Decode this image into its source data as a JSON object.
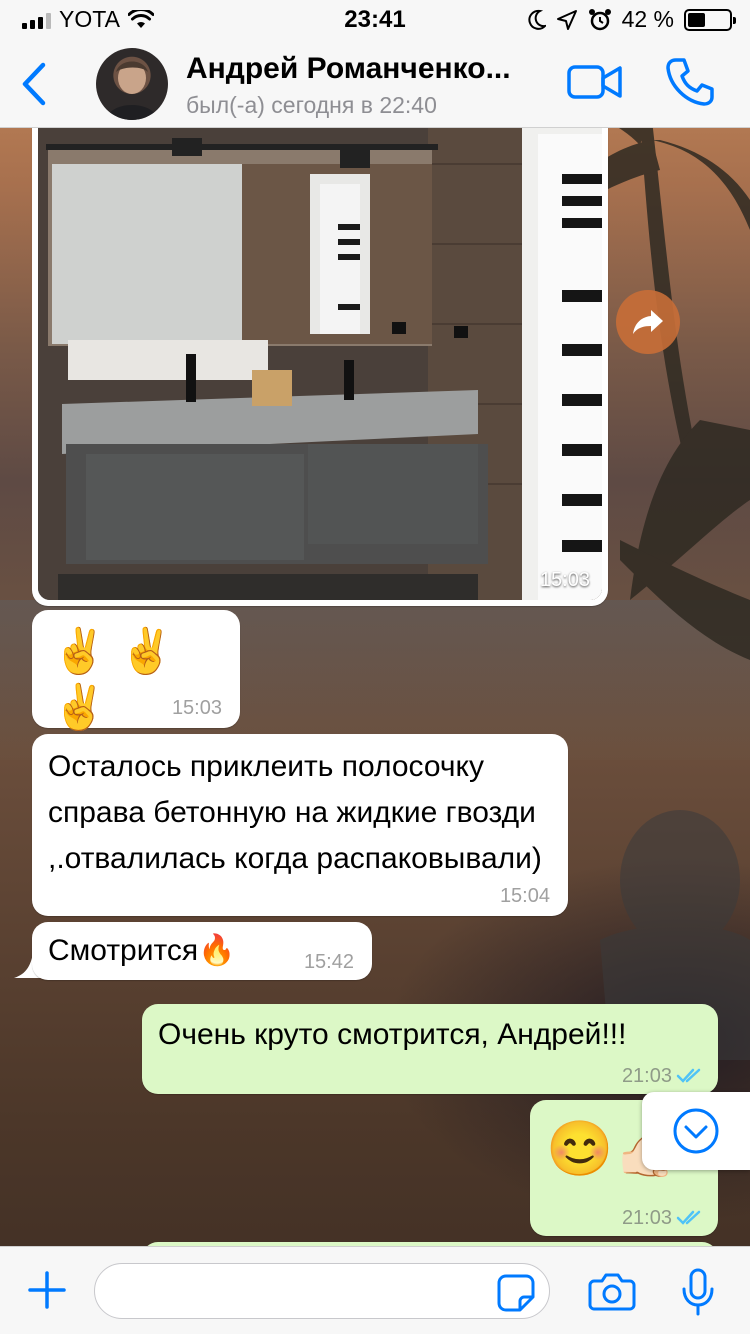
{
  "status_bar": {
    "carrier": "YOTA",
    "time": "23:41",
    "battery_percent": "42 %",
    "battery_level": 0.42,
    "icons": [
      "signal-icon",
      "wifi-icon",
      "moon-icon",
      "location-icon",
      "alarm-icon",
      "battery-icon"
    ]
  },
  "header": {
    "contact_name": "Андрей Романченко...",
    "contact_status": "был(-а) сегодня в 22:40",
    "icons": [
      "back-chevron-icon",
      "video-call-icon",
      "phone-call-icon"
    ]
  },
  "messages": [
    {
      "type": "photo",
      "direction": "in",
      "time": "15:03"
    },
    {
      "type": "text",
      "direction": "in",
      "text": "✌️ ✌️ ✌️",
      "time": "15:03"
    },
    {
      "type": "text",
      "direction": "in",
      "text": "Осталось приклеить полосочку справа бетонную на жидкие гвозди ,.отвалилась когда распаковывали)",
      "time": "15:04"
    },
    {
      "type": "text",
      "direction": "in",
      "text": "Смотрится🔥",
      "time": "15:42"
    },
    {
      "type": "text",
      "direction": "out",
      "text": "Очень круто смотрится, Андрей!!!",
      "time": "21:03",
      "read": true
    },
    {
      "type": "emoji",
      "direction": "out",
      "text": "😊👍🏻",
      "time": "21:03",
      "read": true
    }
  ],
  "input_bar": {
    "placeholder": "",
    "icons": [
      "plus-icon",
      "sticker-icon",
      "camera-icon",
      "microphone-icon"
    ]
  },
  "colors": {
    "accent": "#007aff",
    "incoming_bubble": "#ffffff",
    "outgoing_bubble": "#dcf8c6",
    "read_ticks": "#4fc3f7",
    "forward_button": "#c86e37"
  }
}
